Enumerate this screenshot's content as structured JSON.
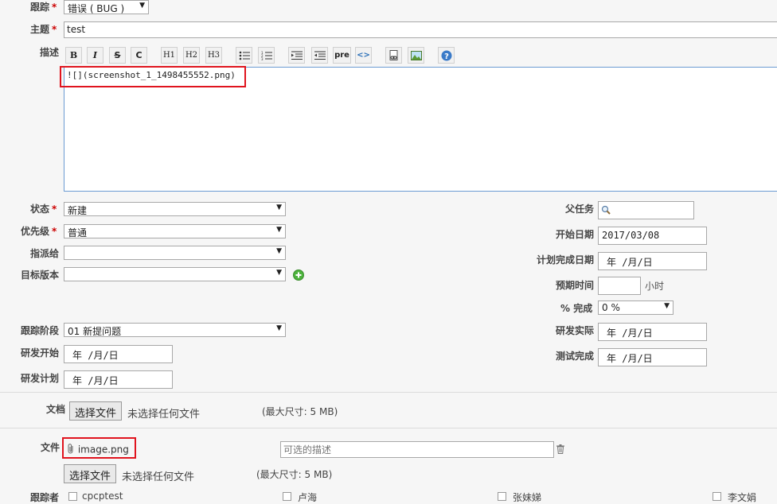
{
  "form": {
    "tracker": {
      "label": "跟踪",
      "value": "错误 ( BUG )"
    },
    "subject": {
      "label": "主题",
      "value": "test"
    },
    "description": {
      "label": "描述",
      "content": "![](screenshot_1_1498455552.png)",
      "toolbar": {
        "bold": "B",
        "italic": "I",
        "strike": "S",
        "code": "C",
        "h1": "H1",
        "h2": "H2",
        "h3": "H3",
        "pre": "pre"
      }
    },
    "status": {
      "label": "状态",
      "value": "新建"
    },
    "priority": {
      "label": "优先级",
      "value": "普通"
    },
    "assignee": {
      "label": "指派给",
      "value": ""
    },
    "target_version": {
      "label": "目标版本",
      "value": ""
    },
    "tracking_stage": {
      "label": "跟踪阶段",
      "value": "01 新提问题"
    },
    "dev_start": {
      "label": "研发开始",
      "value": "年 /月/日"
    },
    "dev_plan": {
      "label": "研发计划",
      "value": "年 /月/日"
    },
    "parent_task": {
      "label": "父任务",
      "value": ""
    },
    "start_date": {
      "label": "开始日期",
      "value": "2017/03/08"
    },
    "due_date": {
      "label": "计划完成日期",
      "value": "年 /月/日"
    },
    "estimated_time": {
      "label": "预期时间",
      "value": "",
      "unit": "小时"
    },
    "done_ratio": {
      "label": "% 完成",
      "value": "0 %"
    },
    "dev_actual": {
      "label": "研发实际",
      "value": "年 /月/日"
    },
    "test_done": {
      "label": "测试完成",
      "value": "年 /月/日"
    }
  },
  "documents": {
    "label": "文档",
    "button": "选择文件",
    "status": "未选择任何文件",
    "max_size": "(最大尺寸: 5 MB)"
  },
  "files": {
    "label": "文件",
    "attached": "image.png",
    "description_placeholder": "可选的描述",
    "button": "选择文件",
    "status": "未选择任何文件",
    "max_size": "(最大尺寸: 5 MB)"
  },
  "watchers": {
    "label": "跟踪者",
    "names": [
      "cpcptest",
      "卢海",
      "张妹娣",
      "李文娟"
    ]
  },
  "colors": {
    "required": "#cc0000",
    "highlight": "#e0141e",
    "editor_border": "#6b9bd2"
  }
}
